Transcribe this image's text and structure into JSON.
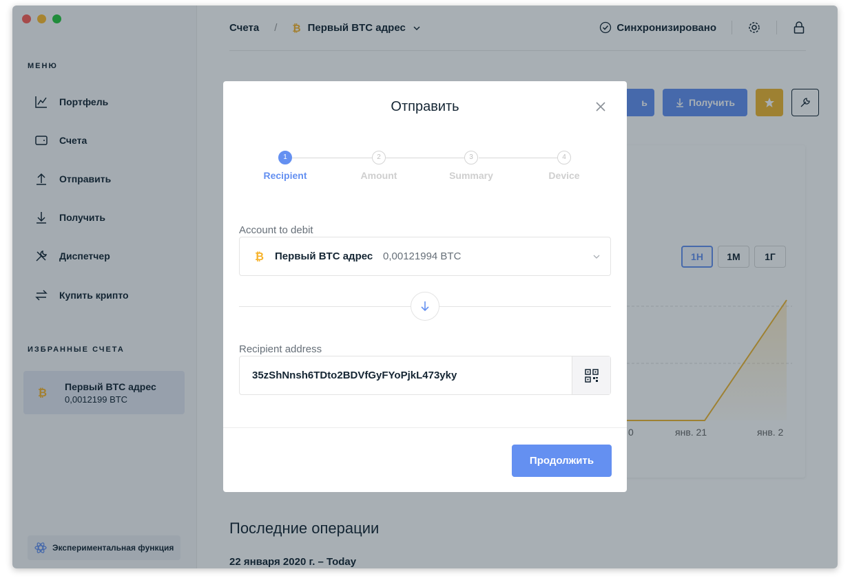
{
  "sidebar": {
    "menu_title": "МЕНЮ",
    "items": [
      {
        "label": "Портфель",
        "icon": "chart-line-icon"
      },
      {
        "label": "Счета",
        "icon": "wallet-icon"
      },
      {
        "label": "Отправить",
        "icon": "arrow-up-icon"
      },
      {
        "label": "Получить",
        "icon": "arrow-down-icon"
      },
      {
        "label": "Диспетчер",
        "icon": "tools-icon"
      },
      {
        "label": "Купить крипто",
        "icon": "exchange-icon"
      }
    ],
    "favorites_title": "ИЗБРАННЫЕ СЧЕТА",
    "favorite": {
      "name": "Первый BTC адрес",
      "balance": "0,0012199 BTC"
    },
    "experimental_label": "Экспериментальная функция"
  },
  "header": {
    "breadcrumb_root": "Счета",
    "breadcrumb_sep": "/",
    "breadcrumb_account": "Первый BTC адрес",
    "sync_status": "Синхронизировано"
  },
  "actions": {
    "send_partial": "ь",
    "receive_label": "Получить"
  },
  "chart": {
    "ranges": [
      "1Н",
      "1М",
      "1Г"
    ],
    "active_range": "1Н",
    "x_labels": [
      "0",
      "янв. 21",
      "янв. 2"
    ]
  },
  "operations": {
    "title": "Последние операции",
    "date": "22 января 2020 г. – Today"
  },
  "modal": {
    "title": "Отправить",
    "steps": [
      {
        "num": "1",
        "label": "Recipient",
        "active": true
      },
      {
        "num": "2",
        "label": "Amount",
        "active": false
      },
      {
        "num": "3",
        "label": "Summary",
        "active": false
      },
      {
        "num": "4",
        "label": "Device",
        "active": false
      }
    ],
    "account_label": "Account to debit",
    "account_name": "Первый BTC адрес",
    "account_balance": "0,00121994 BTC",
    "recipient_label": "Recipient address",
    "recipient_value": "35zShNnsh6TDto2BDVfGyFYoPjkL473yky",
    "continue_label": "Продолжить"
  },
  "colors": {
    "accent": "#6490f1",
    "bitcoin": "#f7b32b",
    "star": "#f0b631",
    "text": "#142533"
  }
}
